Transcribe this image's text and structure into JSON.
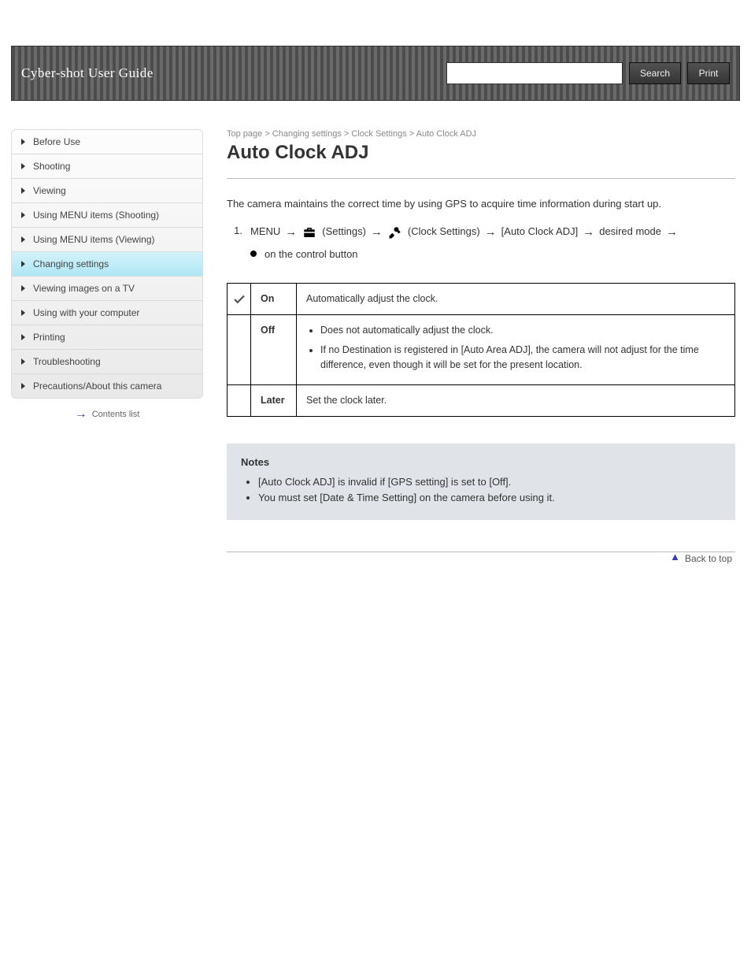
{
  "header": {
    "brand": "Cyber-shot User Guide",
    "search_placeholder": "",
    "search_button": "Search",
    "print_button": "Print"
  },
  "sidebar": {
    "items": [
      {
        "label": "Before Use"
      },
      {
        "label": "Shooting"
      },
      {
        "label": "Viewing"
      },
      {
        "label": "Using MENU items (Shooting)"
      },
      {
        "label": "Using MENU items (Viewing)"
      },
      {
        "label": "Changing settings"
      },
      {
        "label": "Viewing images on a TV"
      },
      {
        "label": "Using with your computer"
      },
      {
        "label": "Printing"
      },
      {
        "label": "Troubleshooting"
      },
      {
        "label": "Precautions/About this camera"
      }
    ],
    "selected_index": 5,
    "collapse_label": "Contents list"
  },
  "main": {
    "topic": "Top page > Changing settings > Clock Settings > Auto Clock ADJ",
    "title": "Auto Clock ADJ",
    "intro": "The camera maintains the correct time by using GPS to acquire time information during start up.",
    "steps": [
      {
        "num": "1.",
        "parts": [
          "MENU",
          "arrow",
          "icon-toolbox",
          "(Settings)",
          "arrow",
          "icon-tools",
          "(Clock Settings)",
          "arrow",
          "[Auto Clock ADJ]",
          "arrow",
          "desired mode",
          "arrow"
        ],
        "tail_mark": "●",
        "tail_text": "on the control button"
      }
    ],
    "table": [
      {
        "icon": "check",
        "label": "On",
        "desc": "Automatically adjust the clock."
      },
      {
        "icon": "",
        "label": "Off",
        "desc_list": [
          "Does not automatically adjust the clock.",
          "If no Destination is registered in [Auto Area ADJ], the camera will not adjust for the time difference, even though it will be set for the present location."
        ]
      },
      {
        "icon": "",
        "label": "Later",
        "desc": "Set the clock later."
      }
    ],
    "note": {
      "heading": "Notes",
      "items": [
        "[Auto Clock ADJ] is invalid if [GPS setting] is set to [Off].",
        "You must set [Date & Time Setting] on the camera before using it."
      ]
    },
    "backtop": "Back to top"
  }
}
